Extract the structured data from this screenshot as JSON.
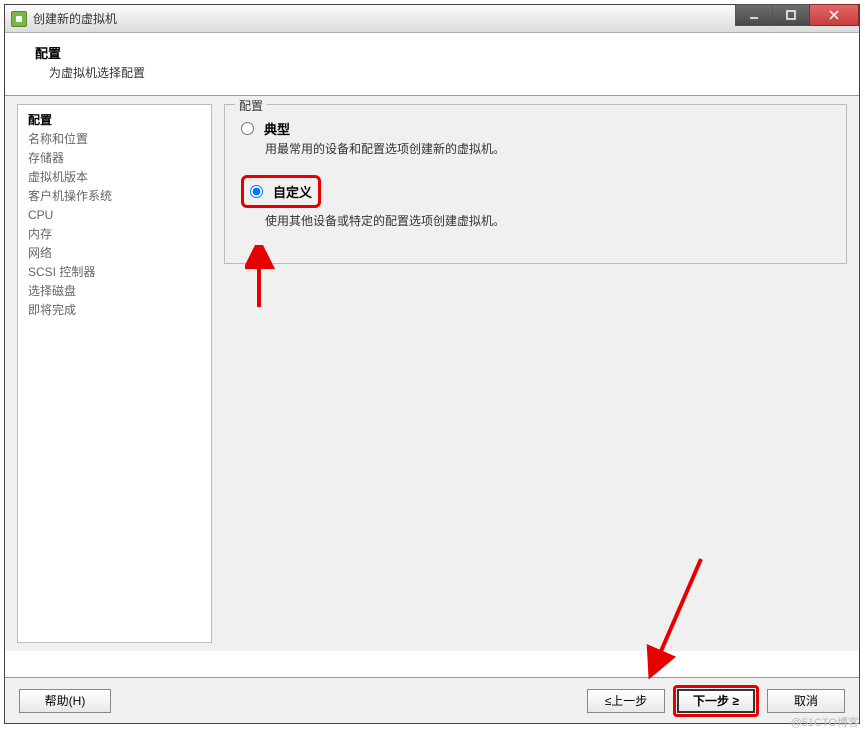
{
  "window": {
    "title": "创建新的虚拟机"
  },
  "header": {
    "title": "配置",
    "subtitle": "为虚拟机选择配置"
  },
  "sidebar": {
    "steps": [
      "配置",
      "名称和位置",
      "存储器",
      "虚拟机版本",
      "客户机操作系统",
      "CPU",
      "内存",
      "网络",
      "SCSI 控制器",
      "选择磁盘",
      "即将完成"
    ],
    "activeIndex": 0
  },
  "main": {
    "fieldsetLegend": "配置",
    "options": {
      "typical": {
        "label": "典型",
        "description": "用最常用的设备和配置选项创建新的虚拟机。"
      },
      "custom": {
        "label": "自定义",
        "description": "使用其他设备或特定的配置选项创建虚拟机。"
      }
    }
  },
  "footer": {
    "help": "帮助(H)",
    "back": "≤上一步",
    "next": "下一步 ≥",
    "cancel": "取消"
  },
  "watermark": "@51CTO博客"
}
